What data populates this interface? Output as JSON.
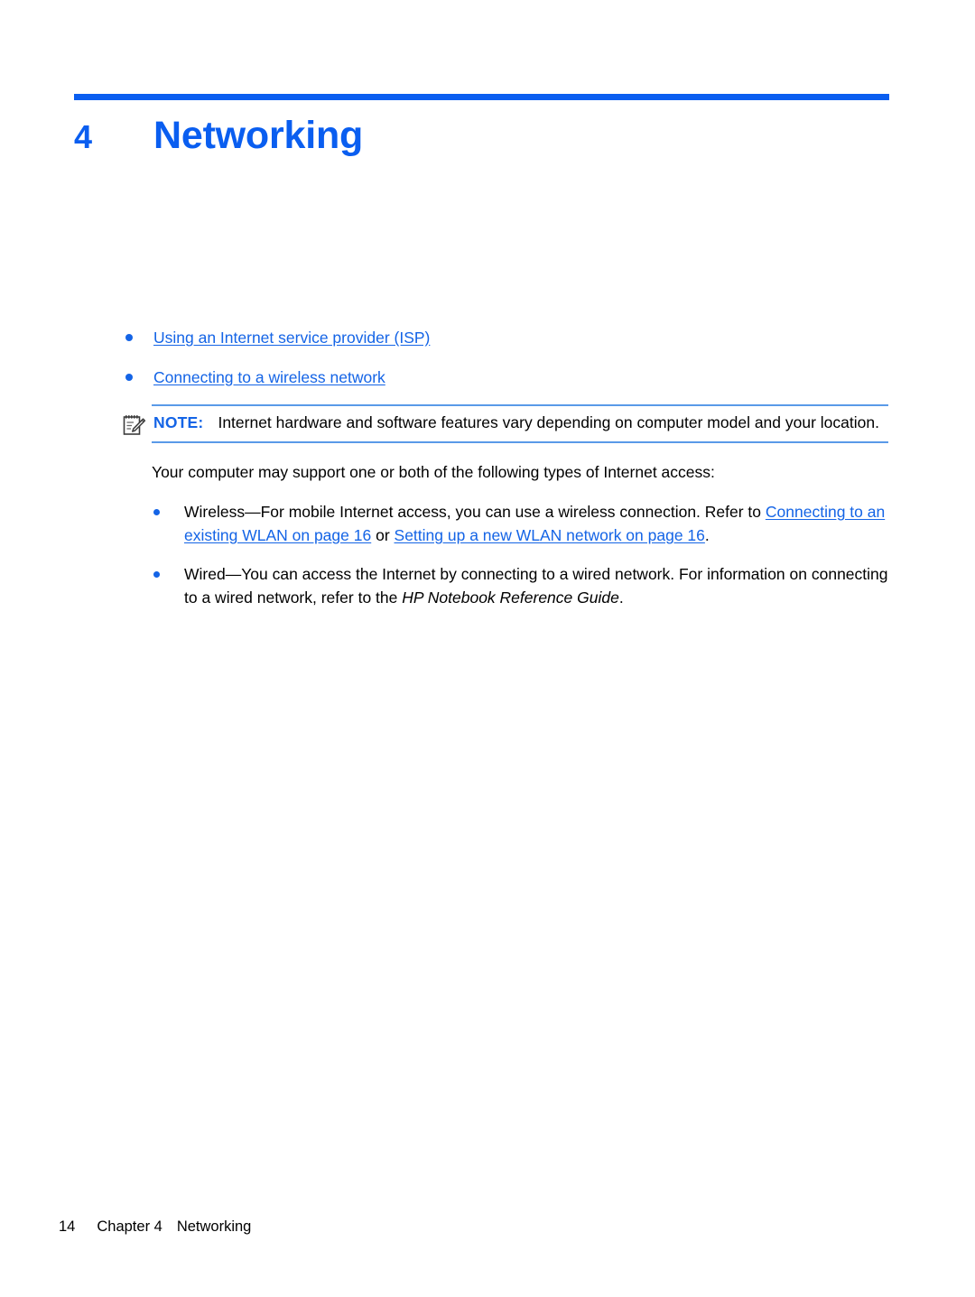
{
  "document": {
    "chapter_number": "4",
    "chapter_title": "Networking",
    "accent_color": "#0a5ef0",
    "link_color": "#1464e6",
    "note_rule_color": "#5a9ae8"
  },
  "toc": {
    "items": [
      {
        "label": "Using an Internet service provider (ISP)"
      },
      {
        "label": "Connecting to a wireless network"
      }
    ]
  },
  "note": {
    "icon": "note-pencil-icon",
    "label": "NOTE:",
    "text": "Internet hardware and software features vary depending on computer model and your location."
  },
  "intro": {
    "text": "Your computer may support one or both of the following types of Internet access:"
  },
  "bullets": {
    "wireless": {
      "lead": "Wireless—For mobile Internet access, you can use a wireless connection. Refer to ",
      "link1": "Connecting to an existing WLAN on page 16",
      "conjunction": " or ",
      "link2": "Setting up a new WLAN network on page 16",
      "tail": "."
    },
    "wired": {
      "lead": "Wired—You can access the Internet by connecting to a wired network. For information on connecting to a wired network, refer to the ",
      "guide_title": "HP Notebook Reference Guide",
      "tail": "."
    }
  },
  "footer": {
    "page_number": "14",
    "chapter_label": "Chapter 4",
    "chapter_title": "Networking"
  }
}
